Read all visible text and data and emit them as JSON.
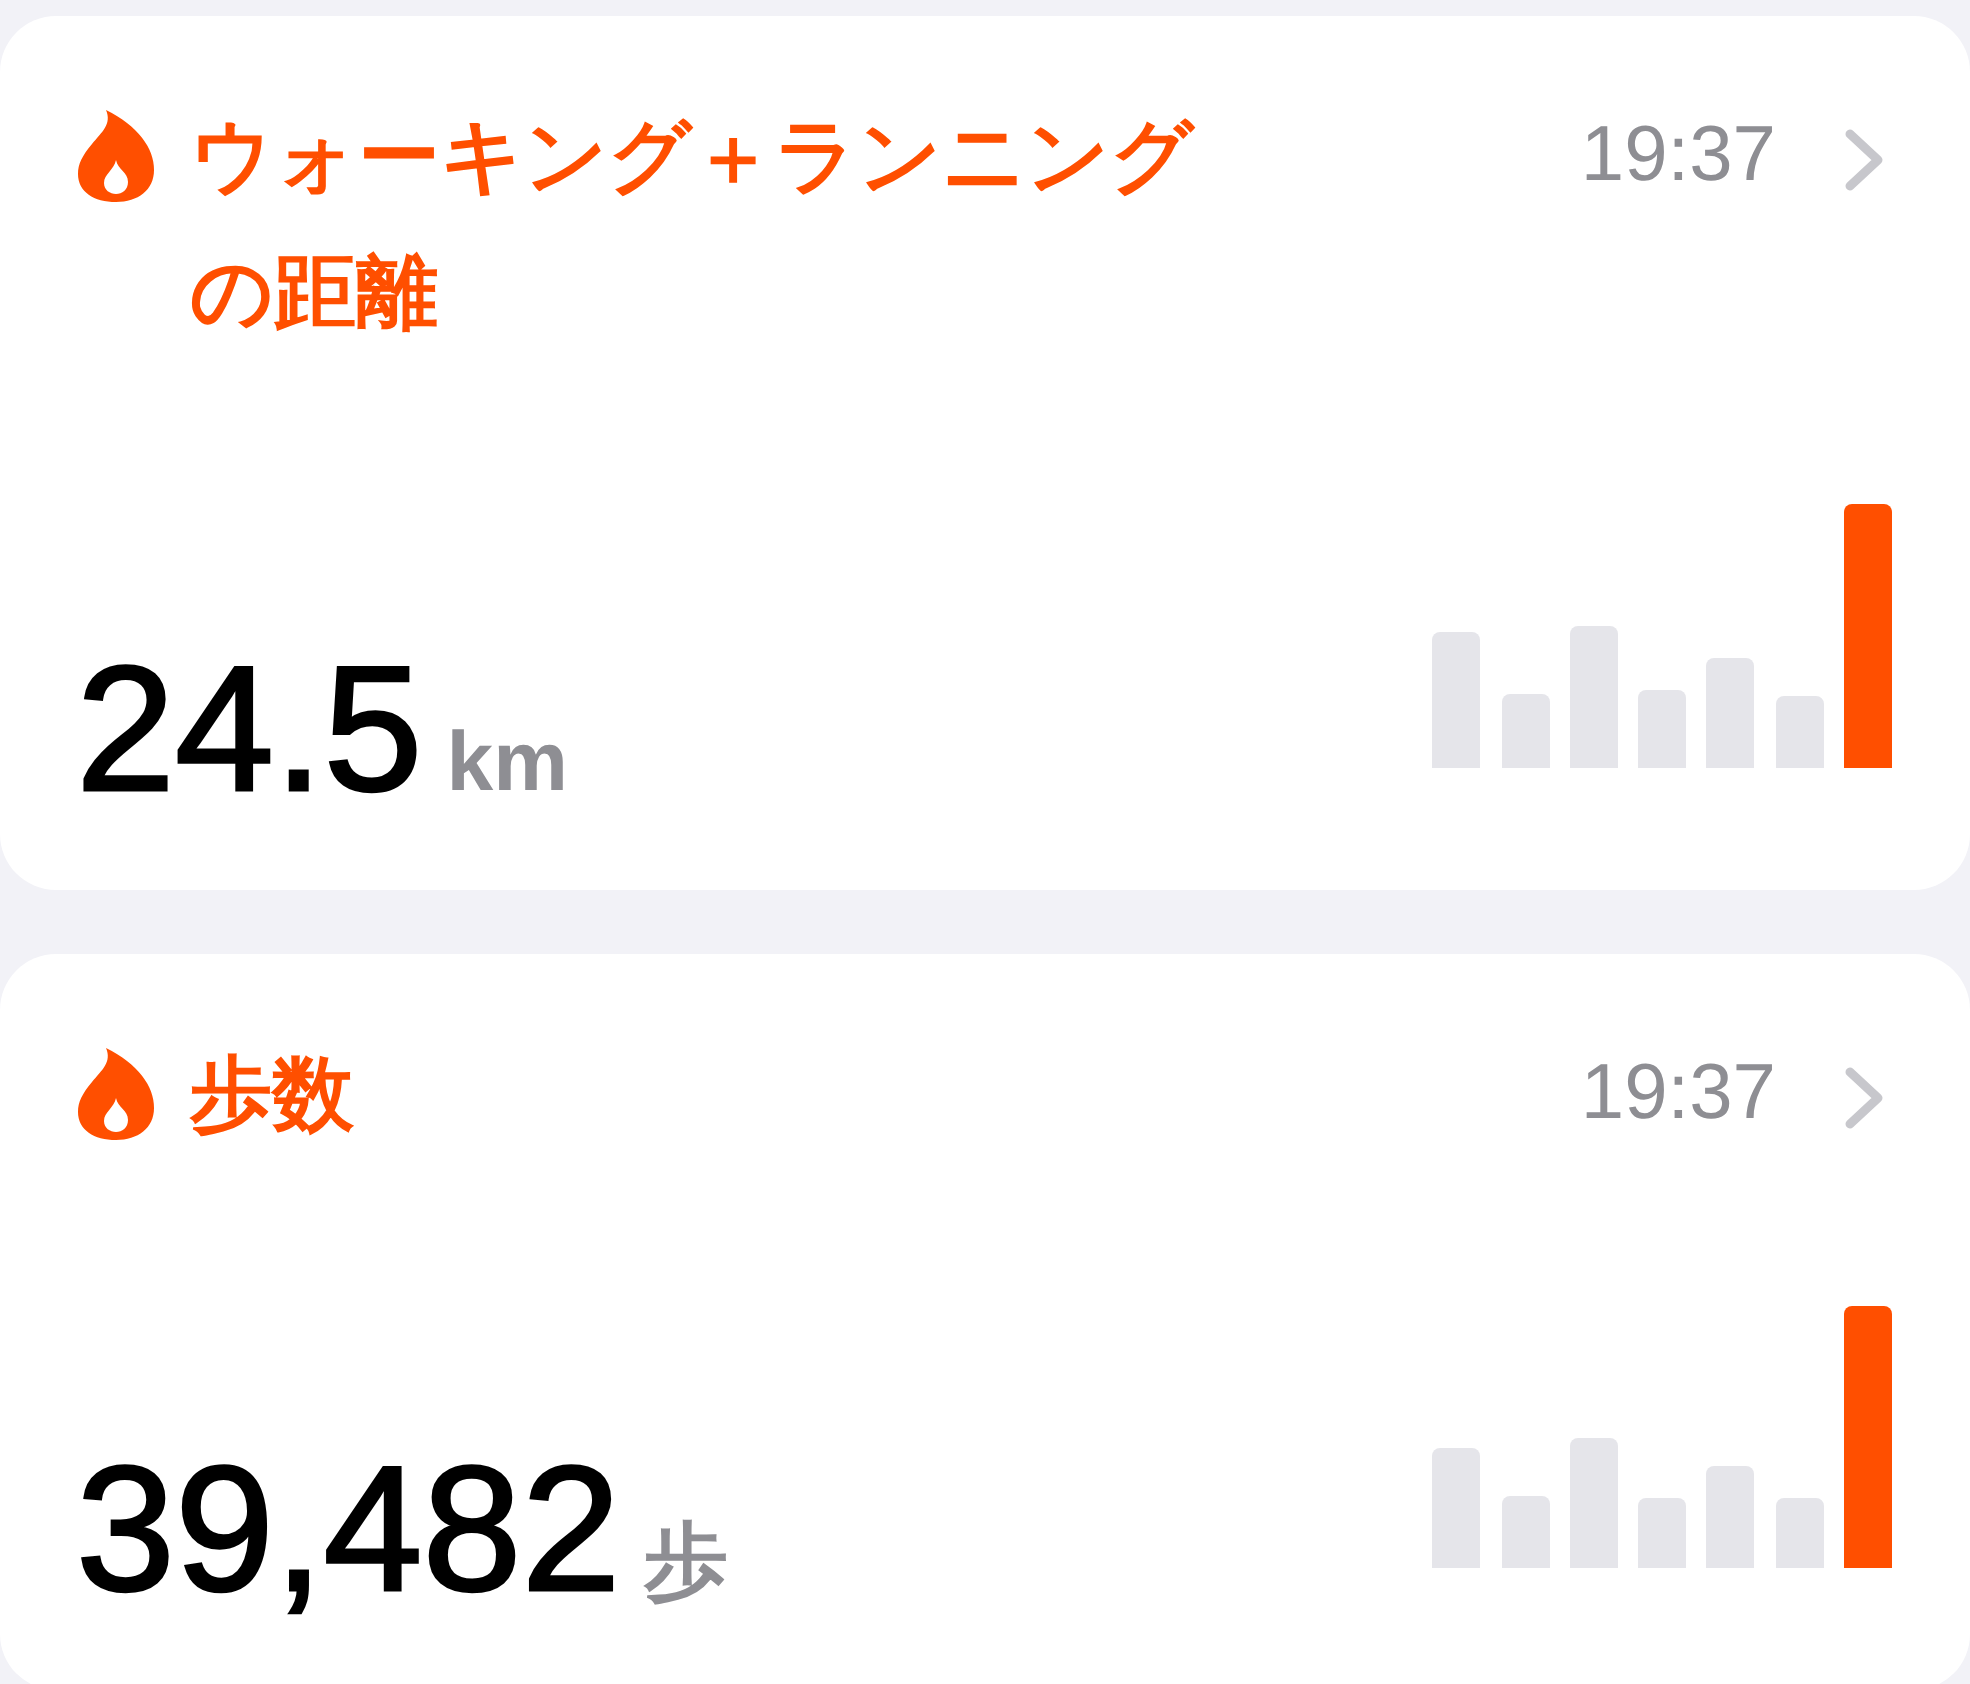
{
  "cards": [
    {
      "title": "ウォーキング＋ランニングの距離",
      "time": "19:37",
      "value": "24.5",
      "unit": "km"
    },
    {
      "title": "歩数",
      "time": "19:37",
      "value": "39,482",
      "unit": "歩"
    }
  ]
}
